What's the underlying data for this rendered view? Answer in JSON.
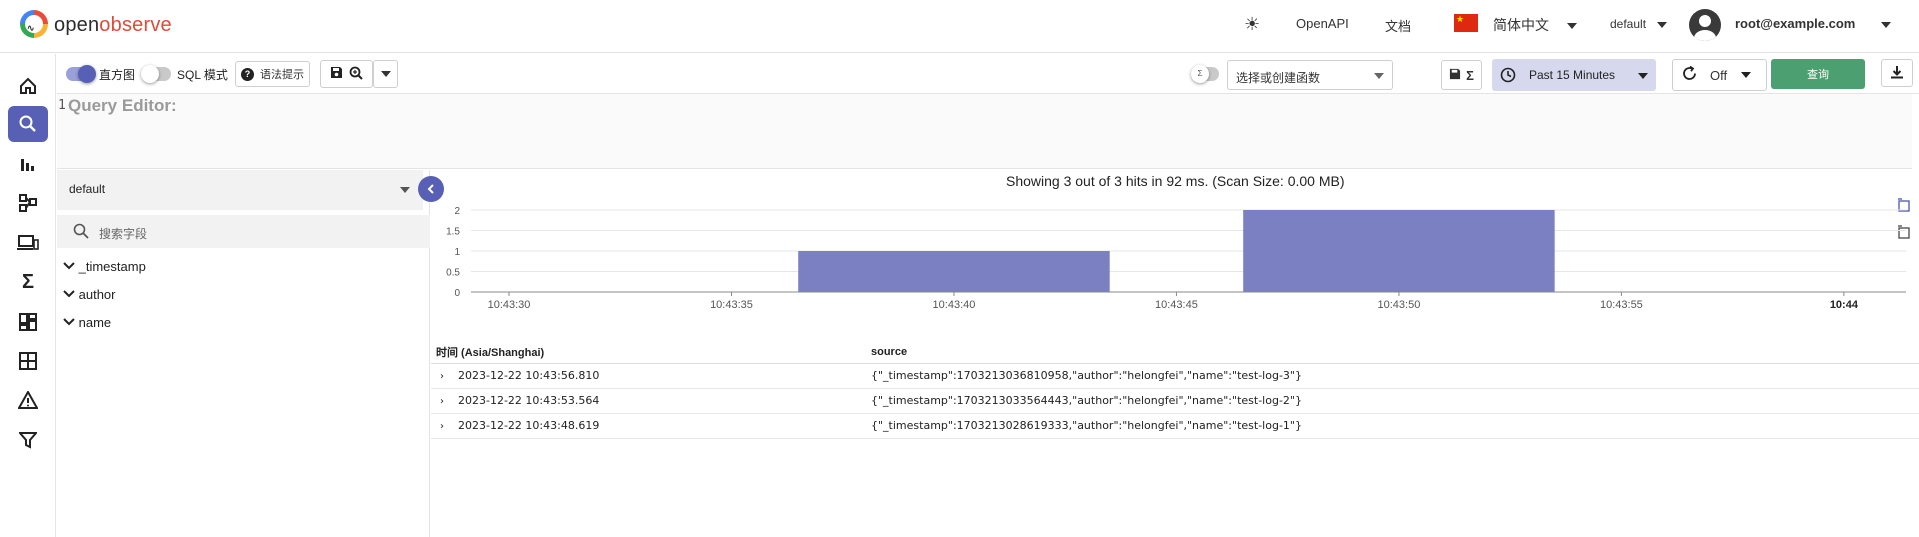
{
  "header": {
    "logo_text_open": "open",
    "logo_text_observe": "observe",
    "openapi_label": "OpenAPI",
    "docs_label": "文档",
    "language_label": "简体中文",
    "org_label": "default",
    "user_email": "root@example.com"
  },
  "nav": {
    "items": [
      {
        "icon": "home-icon"
      },
      {
        "icon": "search-icon",
        "active": true
      },
      {
        "icon": "bar-chart-icon"
      },
      {
        "icon": "flow-chart-icon"
      },
      {
        "icon": "devices-icon"
      },
      {
        "icon": "sigma-icon"
      },
      {
        "icon": "dashboard-icon"
      },
      {
        "icon": "grid-icon"
      },
      {
        "icon": "alert-icon"
      },
      {
        "icon": "filter-icon"
      }
    ]
  },
  "toolbar": {
    "histogram_label": "直方图",
    "histogram_on": true,
    "sql_mode_label": "SQL 模式",
    "sql_mode_on": false,
    "syntax_hint_label": "语法提示",
    "function_placeholder": "选择或创建函数",
    "time_range_label": "Past 15 Minutes",
    "refresh_label": "Off",
    "run_query_label": "查询"
  },
  "editor": {
    "line_number": "1",
    "placeholder": "Query Editor:"
  },
  "field_panel": {
    "stream_name": "default",
    "search_placeholder": "搜索字段",
    "fields": [
      "_timestamp",
      "author",
      "name"
    ]
  },
  "results": {
    "summary": "Showing 3 out of 3 hits in 92 ms. (Scan Size: 0.00 MB)",
    "columns": [
      "时间 (Asia/Shanghai)",
      "source"
    ],
    "rows": [
      {
        "time": "2023-12-22 10:43:56.810",
        "source": "{\"_timestamp\":1703213036810958,\"author\":\"helongfei\",\"name\":\"test-log-3\"}"
      },
      {
        "time": "2023-12-22 10:43:53.564",
        "source": "{\"_timestamp\":1703213033564443,\"author\":\"helongfei\",\"name\":\"test-log-2\"}"
      },
      {
        "time": "2023-12-22 10:43:48.619",
        "source": "{\"_timestamp\":1703213028619333,\"author\":\"helongfei\",\"name\":\"test-log-1\"}"
      }
    ]
  },
  "chart_data": {
    "type": "bar",
    "x_ticks": [
      "10:43:30",
      "10:43:35",
      "10:43:40",
      "10:43:45",
      "10:43:50",
      "10:43:55",
      "10:44"
    ],
    "y_ticks": [
      "0",
      "0.5",
      "1",
      "1.5",
      "2"
    ],
    "ylim": [
      0,
      2
    ],
    "bars": [
      {
        "start": "10:43:36.5",
        "end": "10:43:43.5",
        "value": 1
      },
      {
        "start": "10:43:46.5",
        "end": "10:43:53.5",
        "value": 2
      }
    ],
    "bar_color": "#7b80c2",
    "grid": true
  },
  "colors": {
    "accent": "#5860b6",
    "run_button": "#4c9f70",
    "time_range_bg": "#d6d9ee"
  }
}
